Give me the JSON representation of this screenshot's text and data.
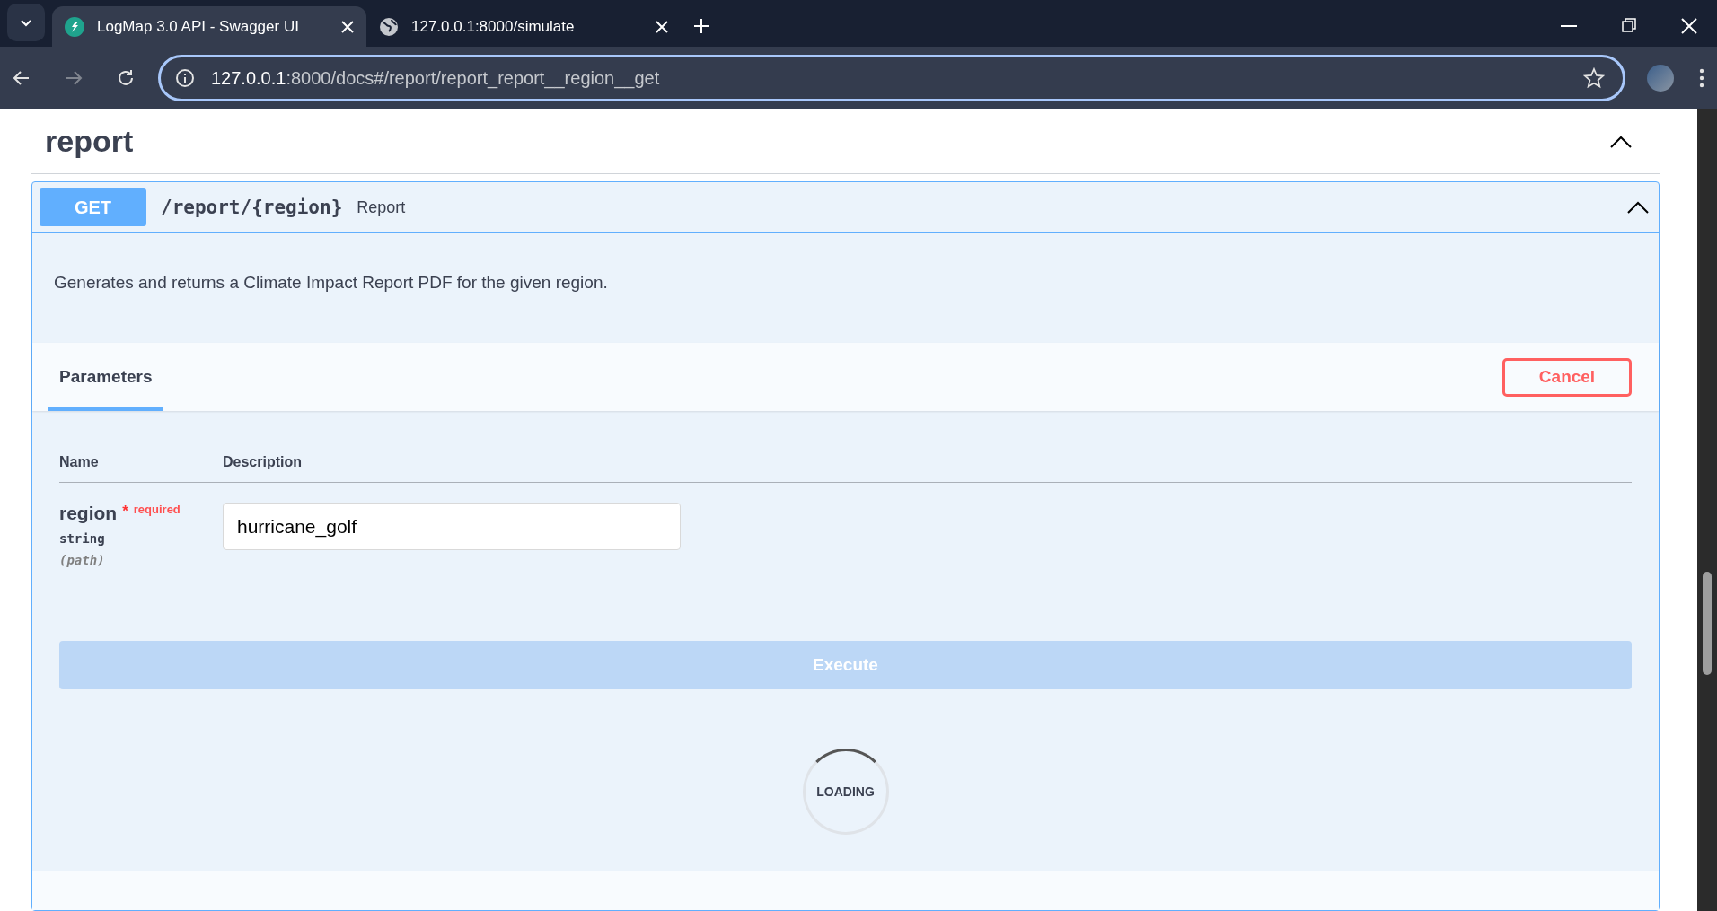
{
  "browser": {
    "tabs": [
      {
        "title": "LogMap 3.0 API - Swagger UI",
        "selected": true,
        "kind": "app"
      },
      {
        "title": "127.0.0.1:8000/simulate",
        "selected": false,
        "kind": "globe"
      }
    ],
    "url_host": "127.0.0.1",
    "url_rest": ":8000/docs#/report/report_report__region__get"
  },
  "section": {
    "title": "report",
    "expanded": true
  },
  "operation": {
    "method": "GET",
    "path": "/report/{region}",
    "summary": "Report",
    "expanded": true,
    "description": "Generates and returns a Climate Impact Report PDF for the given region.",
    "tab": {
      "label": "Parameters",
      "selected": true
    },
    "cancel": "Cancel",
    "columns": [
      "Name",
      "Description"
    ],
    "parameters": [
      {
        "name": "region",
        "star": "*",
        "required": "required",
        "type": "string",
        "location": "(path)",
        "value": "hurricane_golf"
      }
    ],
    "execute": {
      "label": "Execute",
      "disabled": true
    },
    "loading": "LOADING"
  }
}
